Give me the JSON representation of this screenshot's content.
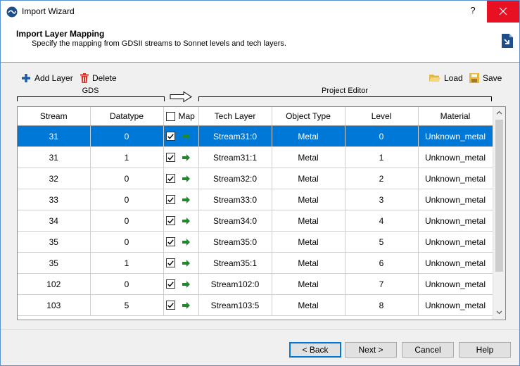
{
  "window": {
    "title": "Import Wizard",
    "help_label": "?"
  },
  "header": {
    "title": "Import Layer Mapping",
    "subtitle": "Specify the mapping from GDSII streams to Sonnet levels and tech layers."
  },
  "toolbar": {
    "add_label": "Add Layer",
    "delete_label": "Delete",
    "load_label": "Load",
    "save_label": "Save"
  },
  "groups": {
    "gds": "GDS",
    "project_editor": "Project Editor"
  },
  "columns": {
    "stream": "Stream",
    "datatype": "Datatype",
    "map": "Map",
    "tech_layer": "Tech Layer",
    "object_type": "Object Type",
    "level": "Level",
    "material": "Material"
  },
  "rows": [
    {
      "stream": "31",
      "datatype": "0",
      "tech_layer": "Stream31:0",
      "object_type": "Metal",
      "level": "0",
      "material": "Unknown_metal"
    },
    {
      "stream": "31",
      "datatype": "1",
      "tech_layer": "Stream31:1",
      "object_type": "Metal",
      "level": "1",
      "material": "Unknown_metal"
    },
    {
      "stream": "32",
      "datatype": "0",
      "tech_layer": "Stream32:0",
      "object_type": "Metal",
      "level": "2",
      "material": "Unknown_metal"
    },
    {
      "stream": "33",
      "datatype": "0",
      "tech_layer": "Stream33:0",
      "object_type": "Metal",
      "level": "3",
      "material": "Unknown_metal"
    },
    {
      "stream": "34",
      "datatype": "0",
      "tech_layer": "Stream34:0",
      "object_type": "Metal",
      "level": "4",
      "material": "Unknown_metal"
    },
    {
      "stream": "35",
      "datatype": "0",
      "tech_layer": "Stream35:0",
      "object_type": "Metal",
      "level": "5",
      "material": "Unknown_metal"
    },
    {
      "stream": "35",
      "datatype": "1",
      "tech_layer": "Stream35:1",
      "object_type": "Metal",
      "level": "6",
      "material": "Unknown_metal"
    },
    {
      "stream": "102",
      "datatype": "0",
      "tech_layer": "Stream102:0",
      "object_type": "Metal",
      "level": "7",
      "material": "Unknown_metal"
    },
    {
      "stream": "103",
      "datatype": "5",
      "tech_layer": "Stream103:5",
      "object_type": "Metal",
      "level": "8",
      "material": "Unknown_metal"
    }
  ],
  "selected_row": 0,
  "buttons": {
    "back": "< Back",
    "next": "Next >",
    "cancel": "Cancel",
    "help": "Help"
  },
  "colors": {
    "selection": "#0078d7",
    "close": "#e81123",
    "add": "#1e5aa8",
    "delete": "#d9342b",
    "map_arrow": "#1f8a2a"
  }
}
